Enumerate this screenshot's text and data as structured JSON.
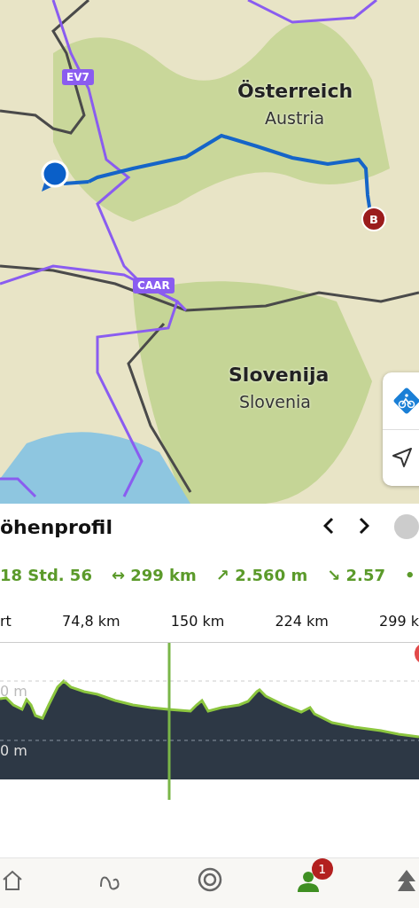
{
  "map": {
    "route_badges": [
      {
        "label": "EV7",
        "kind": "top"
      },
      {
        "label": "CAAR",
        "kind": "bottom"
      }
    ],
    "countries": [
      {
        "name": "Österreich",
        "translation": "Austria",
        "kind": "north"
      },
      {
        "name": "Slovenija",
        "translation": "Slovenia",
        "kind": "south"
      }
    ],
    "end_marker": "B"
  },
  "profile": {
    "title": "öhenprofil",
    "stats": [
      {
        "text": "18 Std. 56"
      },
      {
        "icon": "↔",
        "text": "299 km"
      },
      {
        "icon": "↗",
        "text": "2.560 m"
      },
      {
        "icon": "↘",
        "text": "2.57"
      },
      {
        "text": "•"
      }
    ],
    "distance_labels": [
      "rt",
      "74,8 km",
      "150 km",
      "224 km",
      "299 k"
    ],
    "elevation_labels": [
      "0 m",
      "0 m"
    ]
  },
  "nav": [
    {
      "kind": "home",
      "selected": false
    },
    {
      "kind": "tours",
      "selected": false
    },
    {
      "kind": "record",
      "selected": false
    },
    {
      "kind": "profile",
      "selected": true,
      "badge": "1"
    },
    {
      "kind": "premium",
      "selected": false
    }
  ]
}
